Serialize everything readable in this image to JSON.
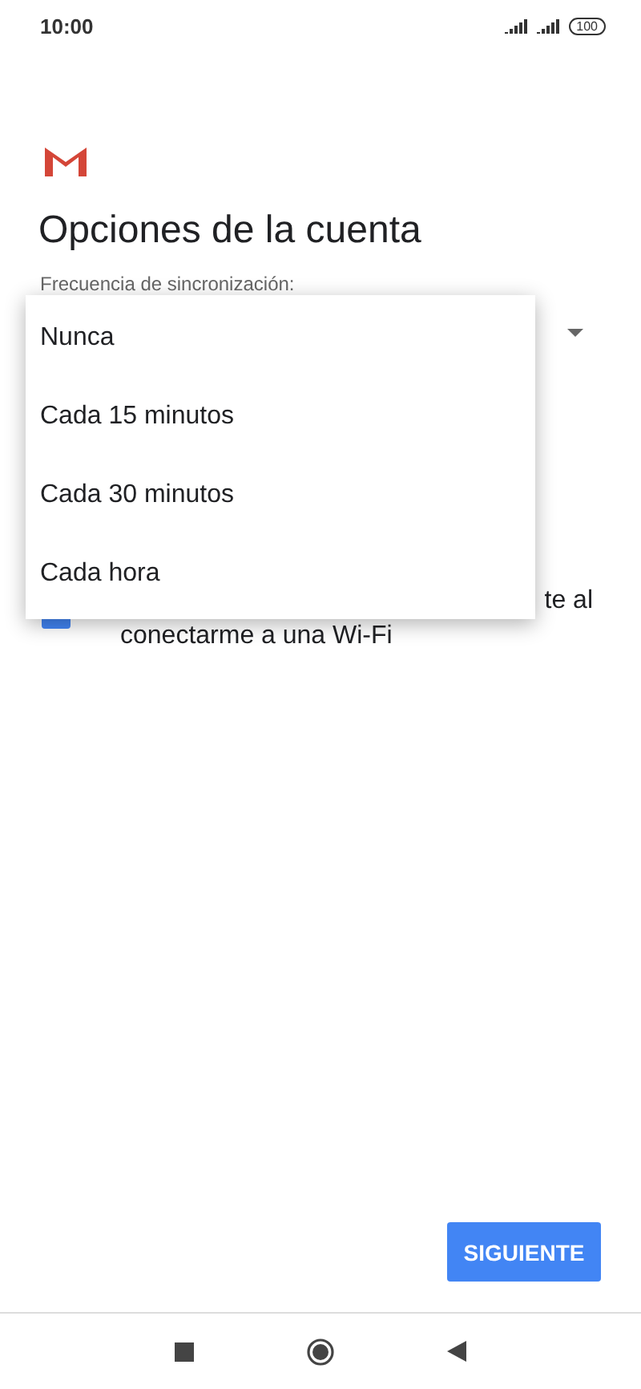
{
  "status_bar": {
    "time": "10:00",
    "battery": "100"
  },
  "title": "Opciones de la cuenta",
  "sync_field": {
    "label": "Frecuencia de sincronización:"
  },
  "wifi_option": {
    "checked": true,
    "line_1_tail": "te al",
    "line_2": "conectarme a una Wi-Fi"
  },
  "menu": {
    "items": [
      {
        "label": "Nunca"
      },
      {
        "label": "Cada 15 minutos"
      },
      {
        "label": "Cada 30 minutos"
      },
      {
        "label": "Cada hora"
      }
    ]
  },
  "next_button": "SIGUIENTE"
}
